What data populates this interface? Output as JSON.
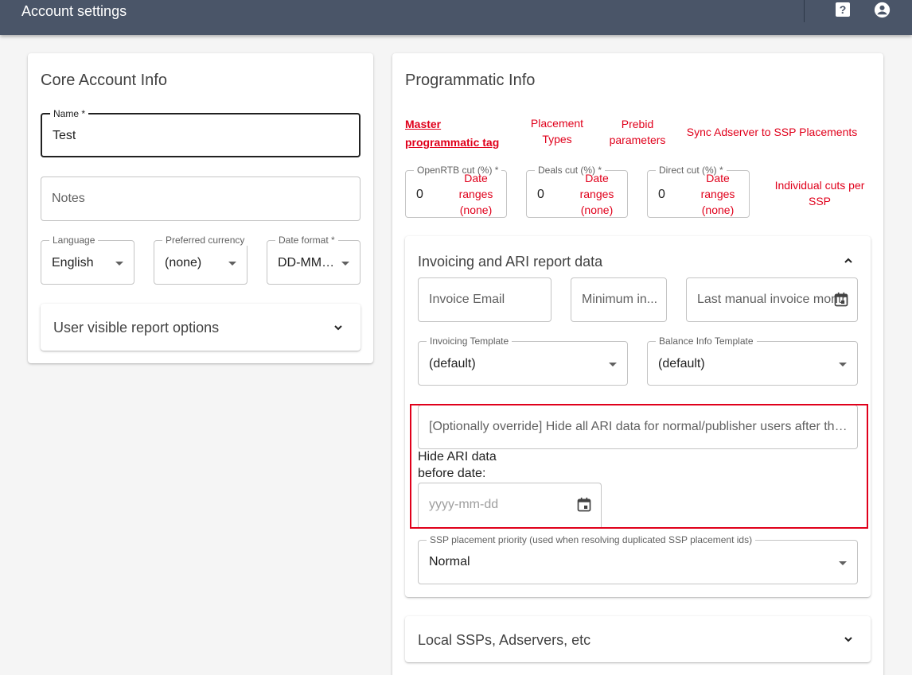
{
  "appbar": {
    "title": "Account settings",
    "help_icon": "help-icon",
    "account_icon": "account-circle-icon"
  },
  "core": {
    "title": "Core Account Info",
    "name": {
      "label": "Name *",
      "value": "Test"
    },
    "notes": {
      "placeholder": "Notes"
    },
    "language": {
      "label": "Language",
      "value": "English"
    },
    "currency": {
      "label": "Preferred currency",
      "value": "(none)"
    },
    "date_format": {
      "label": "Date format *",
      "value": "DD-MM-..."
    },
    "report_options": "User visible report options"
  },
  "programmatic": {
    "title": "Programmatic Info",
    "links": {
      "master_tag": "Master\nprogrammatic tag",
      "placement_types": "Placement\nTypes",
      "prebid": "Prebid\nparameters",
      "sync": "Sync Adserver to SSP Placements",
      "individual_cuts": "Individual cuts per\nSSP"
    },
    "cuts": [
      {
        "label": "OpenRTB cut (%) *",
        "value": "0",
        "ranges": "Date\nranges\n(none)"
      },
      {
        "label": "Deals cut (%) *",
        "value": "0",
        "ranges": "Date\nranges\n(none)"
      },
      {
        "label": "Direct cut (%) *",
        "value": "0",
        "ranges": "Date\nranges\n(none)"
      }
    ],
    "invoicing": {
      "title": "Invoicing and ARI report data",
      "invoice_email": "Invoice Email",
      "minimum": "Minimum in...",
      "last_manual": "Last manual invoice month",
      "invoicing_template": {
        "label": "Invoicing Template",
        "value": "(default)"
      },
      "balance_template": {
        "label": "Balance Info Template",
        "value": "(default)"
      },
      "override_placeholder": "[Optionally override] Hide all ARI data for normal/publisher users after this...",
      "hide_label": "Hide ARI data\nbefore date:",
      "date_placeholder": "yyyy-mm-dd",
      "ssp_priority": {
        "label": "SSP placement priority (used when resolving duplicated SSP placement ids)",
        "value": "Normal"
      }
    },
    "local_ssps": "Local SSPs, Adservers, etc"
  },
  "colors": {
    "appbar": "#4a5568",
    "link_red": "#e0001b"
  }
}
